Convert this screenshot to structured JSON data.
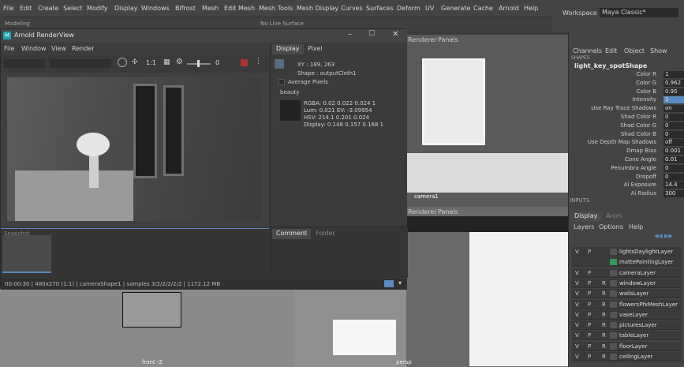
{
  "menubar": [
    "File",
    "Edit",
    "Create",
    "Select",
    "Modify",
    "Display",
    "Windows",
    "Bifrost",
    "Mesh",
    "Edit Mesh",
    "Mesh Tools",
    "Mesh Display",
    "Curves",
    "Surfaces",
    "Deform",
    "UV",
    "Generate",
    "Cache",
    "Arnold",
    "Help"
  ],
  "shelf": {
    "mode": "Modeling",
    "live_surface": "No Live Surface"
  },
  "workspace": {
    "label": "Workspace :",
    "value": "Maya Classic*"
  },
  "render_view": {
    "title": "Arnold RenderView",
    "menu": [
      "File",
      "Window",
      "View",
      "Render"
    ],
    "toolbar": {
      "scale": "1:1",
      "exposure": "0"
    },
    "status": "00:00:30 | 480x270 (1:1) | cameraShape1 | samples 3/2/2/2/2/2 | 1172.12 MB",
    "snapshot_label": "Snapshot"
  },
  "pixel_panel": {
    "tabs": [
      "Display",
      "Pixel"
    ],
    "xy": "XY : 189, 263",
    "shape": "Shape : outputCloth1",
    "average": "Average Pixels",
    "aov": "beauty",
    "rgba": "RGBA:   0.02   0.022   0.024   1",
    "lum": "Lum:     0.021      EV:  -3.09954",
    "hsv": "HSV:    214.1   0.201   0.024",
    "display": "Display: 0.148  0.157  0.168  1",
    "bottom_tabs": [
      "Comment",
      "Folder"
    ]
  },
  "viewport_top": {
    "menu": [
      "Renderer",
      "Panels"
    ],
    "camera": "camera1"
  },
  "viewport_bottom": {
    "menu": [
      "Renderer",
      "Panels"
    ]
  },
  "viewport_front": {
    "label": "front -Z"
  },
  "viewport_persp": {
    "label": "persp"
  },
  "channel_box": {
    "menu": [
      "Channels",
      "Edit",
      "Object",
      "Show"
    ],
    "shapes_header": "SHAPES",
    "shape_name": "light_key_spotShape",
    "attributes": [
      {
        "label": "Color R",
        "value": "1"
      },
      {
        "label": "Color G",
        "value": "0.962"
      },
      {
        "label": "Color B",
        "value": "0.95"
      },
      {
        "label": "Intensity",
        "value": "1"
      },
      {
        "label": "Use Ray Trace Shadows",
        "value": "on"
      },
      {
        "label": "Shad Color R",
        "value": "0"
      },
      {
        "label": "Shad Color G",
        "value": "0"
      },
      {
        "label": "Shad Color B",
        "value": "0"
      },
      {
        "label": "Use Depth Map Shadows",
        "value": "off"
      },
      {
        "label": "Dmap Bias",
        "value": "0.001"
      },
      {
        "label": "Cone Angle",
        "value": "0.01"
      },
      {
        "label": "Penumbra Angle",
        "value": "0"
      },
      {
        "label": "Dropoff",
        "value": "0"
      },
      {
        "label": "Ai Exposure",
        "value": "14.4"
      },
      {
        "label": "Ai Radius",
        "value": "300"
      }
    ],
    "inputs_header": "INPUTS",
    "layer_tabs": [
      "Display",
      "Anim"
    ],
    "layer_menu": [
      "Layers",
      "Options",
      "Help"
    ],
    "layers": [
      {
        "v": "V",
        "p": "P",
        "r": "",
        "name": "lightsDaylightLayer"
      },
      {
        "v": "",
        "p": "",
        "r": "",
        "name": "mattePaintingLayer"
      },
      {
        "v": "V",
        "p": "P",
        "r": "",
        "name": "cameraLayer"
      },
      {
        "v": "V",
        "p": "P",
        "r": "R",
        "name": "windowLayer"
      },
      {
        "v": "V",
        "p": "P",
        "r": "R",
        "name": "wallsLayer"
      },
      {
        "v": "V",
        "p": "P",
        "r": "R",
        "name": "flowersPfxMeshLayer"
      },
      {
        "v": "V",
        "p": "P",
        "r": "R",
        "name": "vaseLayer"
      },
      {
        "v": "V",
        "p": "P",
        "r": "R",
        "name": "picturesLayer"
      },
      {
        "v": "V",
        "p": "P",
        "r": "R",
        "name": "tableLayer"
      },
      {
        "v": "V",
        "p": "P",
        "r": "R",
        "name": "floorLayer"
      },
      {
        "v": "V",
        "p": "P",
        "r": "R",
        "name": "ceilingLayer"
      }
    ]
  },
  "colors": {
    "accent": "#5a8ac0",
    "green_swatch": "#2f9a5a",
    "red_lines": "#c83c3c"
  }
}
